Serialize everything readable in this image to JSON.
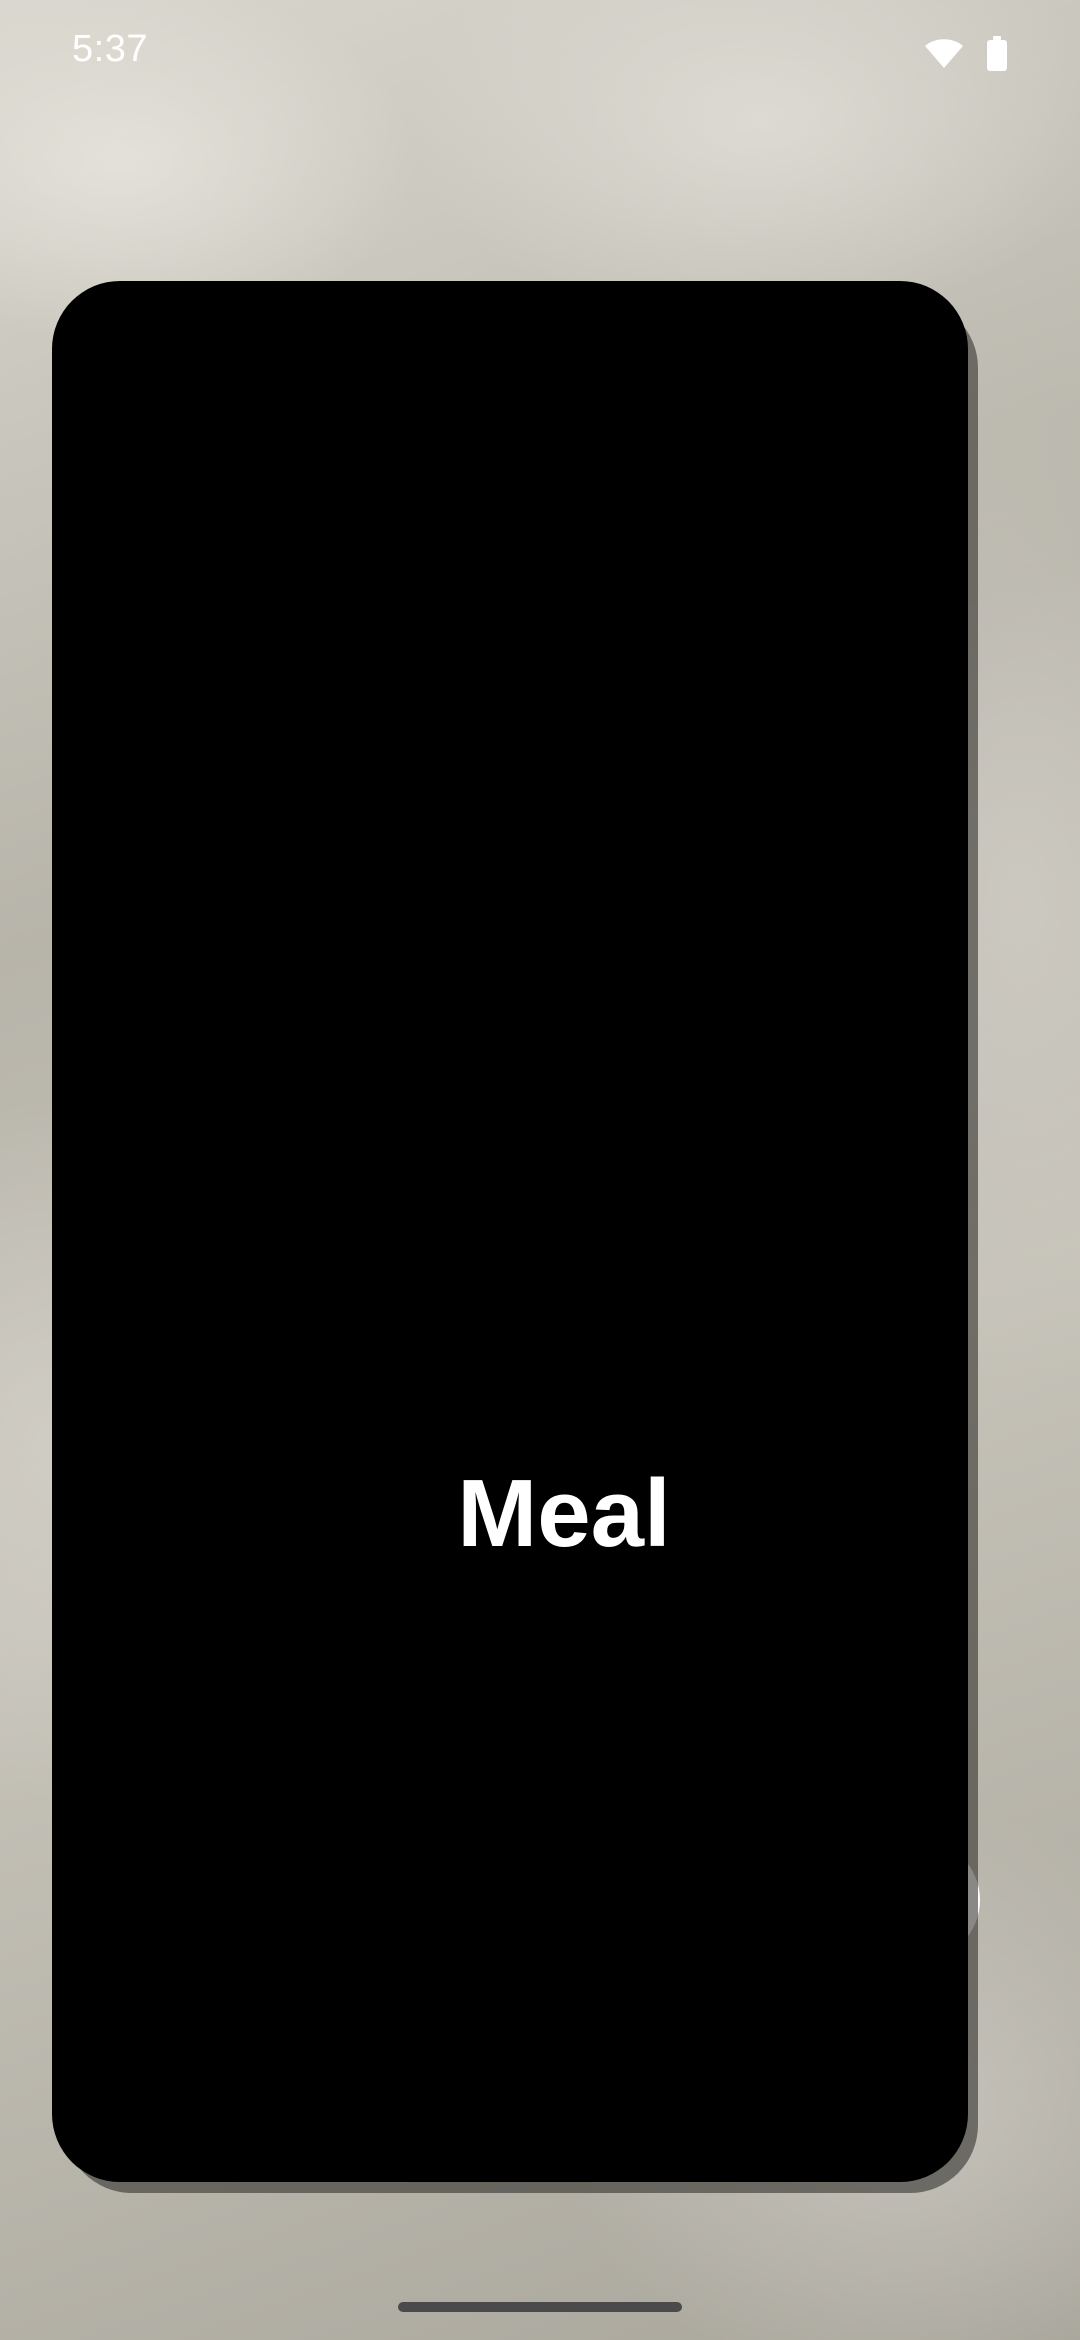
{
  "status_bar": {
    "time": "5:37",
    "icons": [
      "wifi-icon",
      "battery-icon"
    ]
  },
  "splash": {
    "app_name": "Meal",
    "background_color": "#000000",
    "text_color": "#ffffff"
  },
  "navigation": {
    "handle": "gesture-nav-handle"
  }
}
